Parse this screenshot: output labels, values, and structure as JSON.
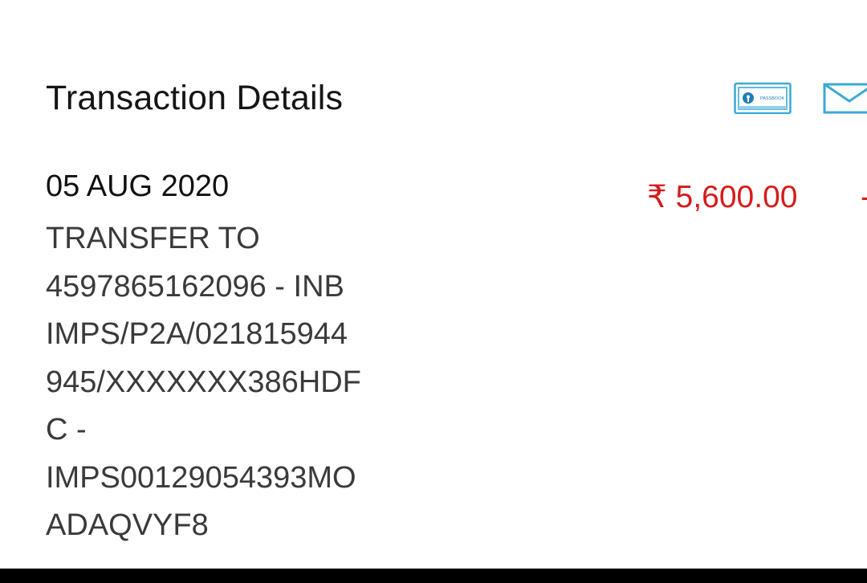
{
  "header": {
    "title": "Transaction Details",
    "passbook_icon": "passbook-icon",
    "mail_icon": "mail-icon",
    "passbook_label": "PASSBOOK",
    "accent_color": "#3aa9d6"
  },
  "transaction": {
    "date": "05 AUG 2020",
    "description_lines": [
      "TRANSFER TO",
      "4597865162096 - INB",
      "IMPS/P2A/021815944",
      "945/XXXXXXX386HDF",
      "C -",
      "IMPS00129054393MO",
      "ADAQVYF8"
    ],
    "amount": "₹ 5,600.00",
    "extra": "-",
    "amount_color": "#d51b1b"
  }
}
